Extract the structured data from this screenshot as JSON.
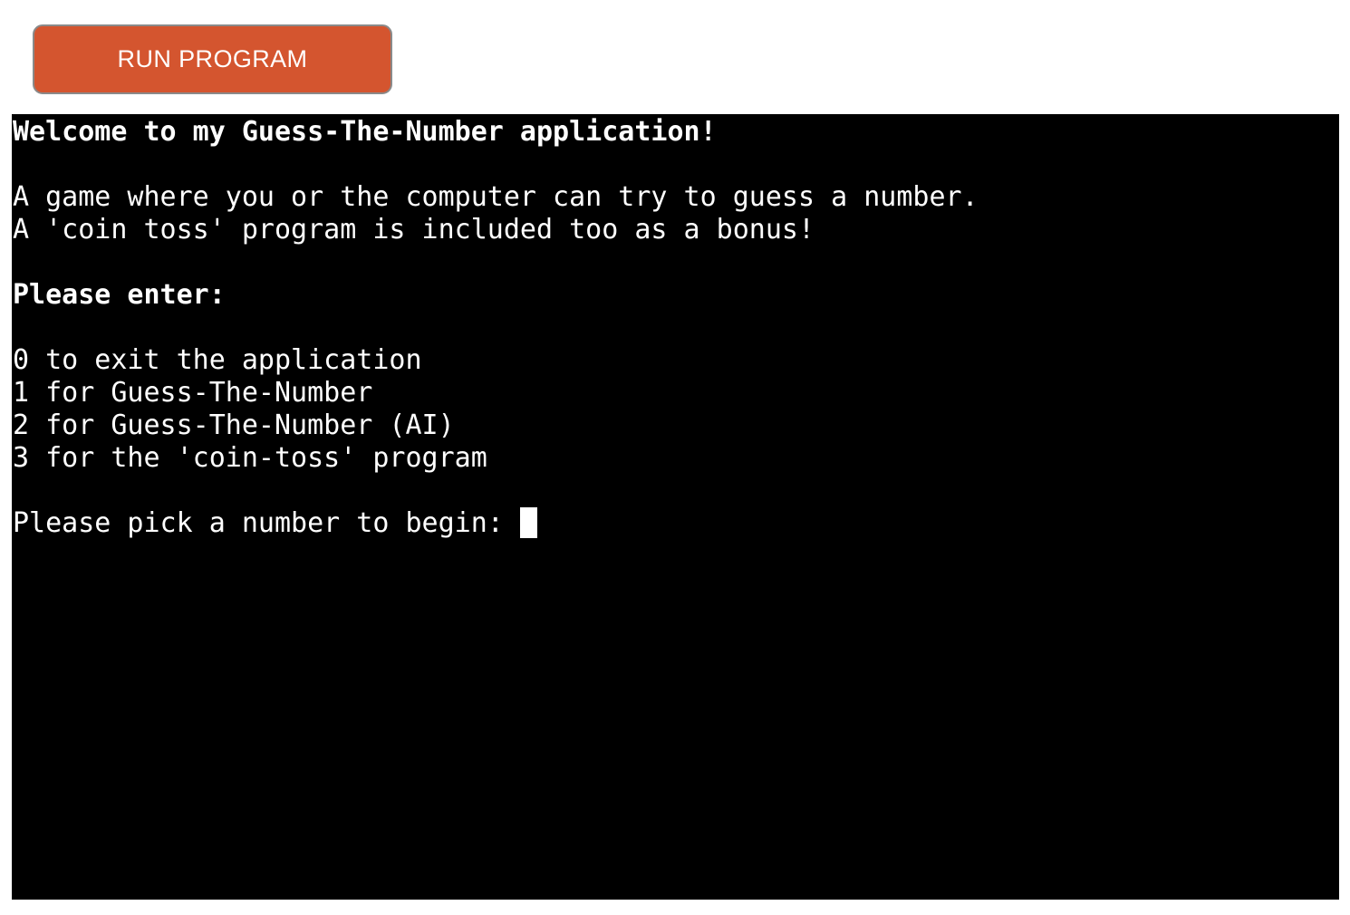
{
  "window": {
    "background_color": "#ffffff"
  },
  "toolbar": {
    "run_button_label": "RUN PROGRAM",
    "run_button_color": "#d4552f",
    "run_button_border_color": "#8a8a8a",
    "run_button_text_color": "#ffffff"
  },
  "terminal": {
    "background_color": "#000000",
    "text_color": "#ffffff",
    "cursor": {
      "shape": "block",
      "color": "#ffffff",
      "visible": true
    },
    "lines": [
      {
        "text": "Welcome to my Guess-The-Number application!",
        "bold": true,
        "cursor": false
      },
      {
        "text": "",
        "bold": false,
        "cursor": false
      },
      {
        "text": "A game where you or the computer can try to guess a number.",
        "bold": false,
        "cursor": false
      },
      {
        "text": "A 'coin toss' program is included too as a bonus!",
        "bold": false,
        "cursor": false
      },
      {
        "text": "",
        "bold": false,
        "cursor": false
      },
      {
        "text": "Please enter:",
        "bold": true,
        "cursor": false
      },
      {
        "text": "",
        "bold": false,
        "cursor": false
      },
      {
        "text": "0 to exit the application",
        "bold": false,
        "cursor": false
      },
      {
        "text": "1 for Guess-The-Number",
        "bold": false,
        "cursor": false
      },
      {
        "text": "2 for Guess-The-Number (AI)",
        "bold": false,
        "cursor": false
      },
      {
        "text": "3 for the 'coin-toss' program",
        "bold": false,
        "cursor": false
      },
      {
        "text": "",
        "bold": false,
        "cursor": false
      },
      {
        "text": "Please pick a number to begin: ",
        "bold": false,
        "cursor": true
      }
    ]
  }
}
